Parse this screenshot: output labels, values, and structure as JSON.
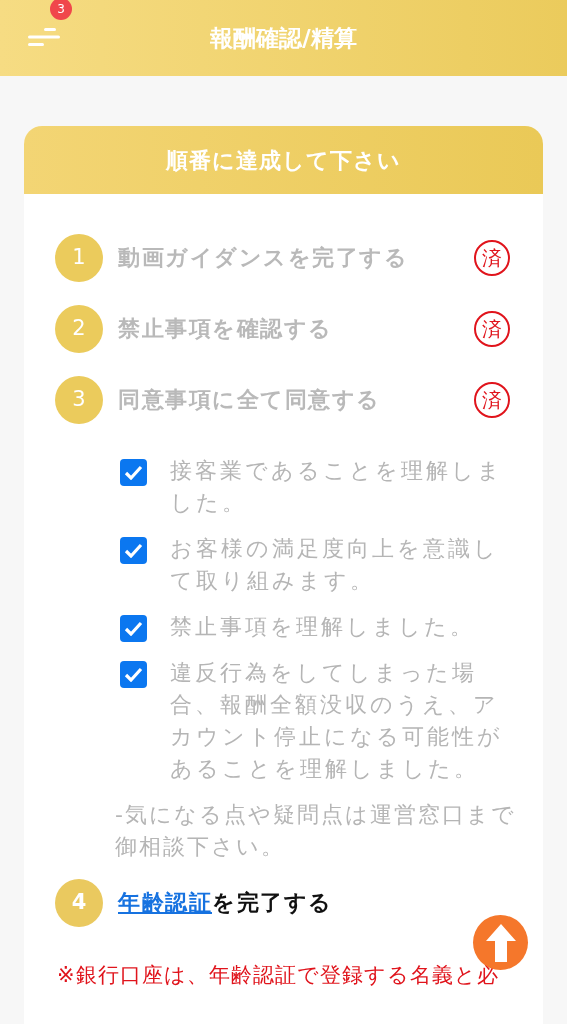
{
  "header": {
    "title": "報酬確認/精算",
    "menu_badge": "3"
  },
  "card": {
    "title": "順番に達成して下さい",
    "steps": [
      {
        "number": "1",
        "text": "動画ガイダンスを完了する",
        "done": true,
        "stamp": "済"
      },
      {
        "number": "2",
        "text": "禁止事項を確認する",
        "done": true,
        "stamp": "済"
      },
      {
        "number": "3",
        "text": "同意事項に全て同意する",
        "done": true,
        "stamp": "済"
      }
    ],
    "agreements": [
      {
        "text": "接客業であることを理解しました。",
        "checked": true
      },
      {
        "text": "お客様の満足度向上を意識して取り組みます。",
        "checked": true
      },
      {
        "text": "禁止事項を理解しました。",
        "checked": true
      },
      {
        "text": "違反行為をしてしまった場合、報酬全額没収のうえ、アカウント停止になる可能性があることを理解しました。",
        "checked": true
      }
    ],
    "note": "-気になる点や疑問点は運営窓口まで御相談下さい。",
    "step4": {
      "number": "4",
      "link": "年齢認証",
      "text": "を完了する",
      "done": false
    },
    "warning": "※銀行口座は、年齢認証で登録する名義と必"
  }
}
